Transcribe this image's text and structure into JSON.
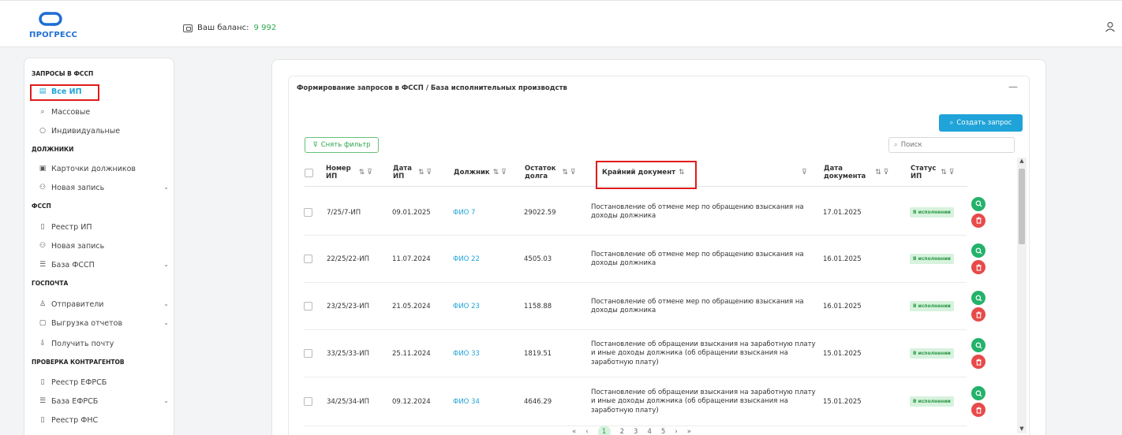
{
  "app": {
    "logo_text": "ПРОГРЕСС"
  },
  "header": {
    "balance_label": "Ваш баланс:",
    "balance_value": "9 992"
  },
  "sidebar": {
    "sections": [
      {
        "title": "ЗАПРОСЫ В ФССП"
      },
      {
        "title": "ДОЛЖНИКИ"
      },
      {
        "title": "ФССП"
      },
      {
        "title": "ГОСПОЧТА"
      },
      {
        "title": "ПРОВЕРКА КОНТРАГЕНТОВ"
      }
    ],
    "items": [
      {
        "label": "Все ИП",
        "icon": "list-icon"
      },
      {
        "label": "Массовые",
        "icon": "search-icon"
      },
      {
        "label": "Индивидуальные",
        "icon": "chat-icon"
      },
      {
        "label": "Карточки должников",
        "icon": "card-icon"
      },
      {
        "label": "Новая запись",
        "icon": "users-icon"
      },
      {
        "label": "Реестр ИП",
        "icon": "file-icon"
      },
      {
        "label": "Новая запись",
        "icon": "users-icon"
      },
      {
        "label": "База ФССП",
        "icon": "database-icon"
      },
      {
        "label": "Отправители",
        "icon": "user-icon"
      },
      {
        "label": "Выгрузка отчетов",
        "icon": "clipboard-icon"
      },
      {
        "label": "Получить почту",
        "icon": "inbox-icon"
      },
      {
        "label": "Реестр ЕФРСБ",
        "icon": "file-icon"
      },
      {
        "label": "База ЕФРСБ",
        "icon": "database-icon"
      },
      {
        "label": "Реестр ФНС",
        "icon": "file-icon"
      }
    ]
  },
  "main": {
    "breadcrumb": "Формирование запросов в ФССП / База исполнительных производств",
    "create_button": "Создать запрос",
    "filter_button": "Снять фильтр",
    "search_placeholder": "Поиск"
  },
  "table": {
    "columns": {
      "num_line1": "Номер",
      "num_line2": "ИП",
      "date_line1": "Дата",
      "date_line2": "ИП",
      "debtor": "Должник",
      "rest_line1": "Остаток",
      "rest_line2": "долга",
      "doc": "Крайний документ",
      "docdate_line1": "Дата",
      "docdate_line2": "документа",
      "status_line1": "Статус",
      "status_line2": "ИП"
    },
    "rows": [
      {
        "num": "7/25/7-ИП",
        "date": "09.01.2025",
        "debtor": "ФИО 7",
        "rest": "29022.59",
        "doc": "Постановление об отмене мер по обращению взыскания на доходы должника",
        "doc_date": "17.01.2025",
        "status": "В исполнении"
      },
      {
        "num": "22/25/22-ИП",
        "date": "11.07.2024",
        "debtor": "ФИО 22",
        "rest": "4505.03",
        "doc": "Постановление об отмене мер по обращению взыскания на доходы должника",
        "doc_date": "16.01.2025",
        "status": "В исполнении"
      },
      {
        "num": "23/25/23-ИП",
        "date": "21.05.2024",
        "debtor": "ФИО 23",
        "rest": "1158.88",
        "doc": "Постановление об отмене мер по обращению взыскания на доходы должника",
        "doc_date": "16.01.2025",
        "status": "В исполнении"
      },
      {
        "num": "33/25/33-ИП",
        "date": "25.11.2024",
        "debtor": "ФИО 33",
        "rest": "1819.51",
        "doc": "Постановление об обращении взыскания на заработную плату и иные доходы должника (об обращении взыскания на заработную плату)",
        "doc_date": "15.01.2025",
        "status": "В исполнении"
      },
      {
        "num": "34/25/34-ИП",
        "date": "09.12.2024",
        "debtor": "ФИО 34",
        "rest": "4646.29",
        "doc": "Постановление об обращении взыскания на заработную плату и иные доходы должника (об обращении взыскания на заработную плату)",
        "doc_date": "15.01.2025",
        "status": "В исполнении"
      }
    ]
  },
  "pagination": {
    "first": "«",
    "prev": "‹",
    "pages": [
      "1",
      "2",
      "3",
      "4",
      "5"
    ],
    "next": "›",
    "last": "»"
  },
  "colors": {
    "accent": "#1fa3d8",
    "success": "#23b26a",
    "danger": "#e84a4a",
    "highlight": "#e01b1b"
  }
}
